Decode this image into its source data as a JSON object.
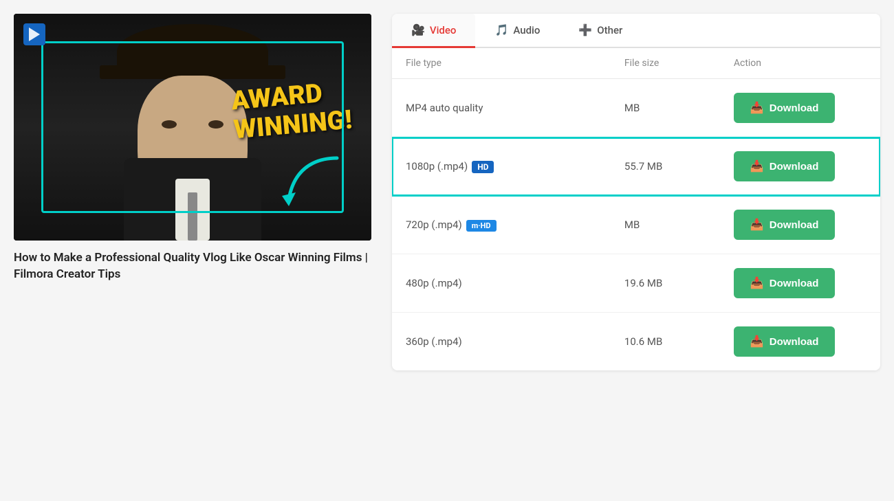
{
  "tabs": [
    {
      "id": "video",
      "label": "Video",
      "icon": "🎥",
      "active": true
    },
    {
      "id": "audio",
      "label": "Audio",
      "icon": "🎵",
      "active": false
    },
    {
      "id": "other",
      "label": "Other",
      "icon": "➕",
      "active": false
    }
  ],
  "table": {
    "headers": {
      "filetype": "File type",
      "filesize": "File size",
      "action": "Action"
    },
    "rows": [
      {
        "id": "mp4-auto",
        "filetype": "MP4 auto quality",
        "badge": null,
        "filesize": "MB",
        "download_label": "Download",
        "highlighted": false
      },
      {
        "id": "1080p",
        "filetype": "1080p (.mp4)",
        "badge": "HD",
        "badge_class": "badge-hd",
        "filesize": "55.7 MB",
        "download_label": "Download",
        "highlighted": true
      },
      {
        "id": "720p",
        "filetype": "720p (.mp4)",
        "badge": "m·HD",
        "badge_class": "badge-mhd",
        "filesize": "MB",
        "download_label": "Download",
        "highlighted": false
      },
      {
        "id": "480p",
        "filetype": "480p (.mp4)",
        "badge": null,
        "filesize": "19.6 MB",
        "download_label": "Download",
        "highlighted": false
      },
      {
        "id": "360p",
        "filetype": "360p (.mp4)",
        "badge": null,
        "filesize": "10.6 MB",
        "download_label": "Download",
        "highlighted": false
      }
    ]
  },
  "video": {
    "title": "How to Make a Professional Quality Vlog Like Oscar Winning Films | Filmora Creator Tips",
    "award_text_line1": "AWARD",
    "award_text_line2": "WINNING!"
  },
  "colors": {
    "accent_green": "#3cb371",
    "accent_cyan": "#00cfc8",
    "active_tab": "#e53935"
  }
}
